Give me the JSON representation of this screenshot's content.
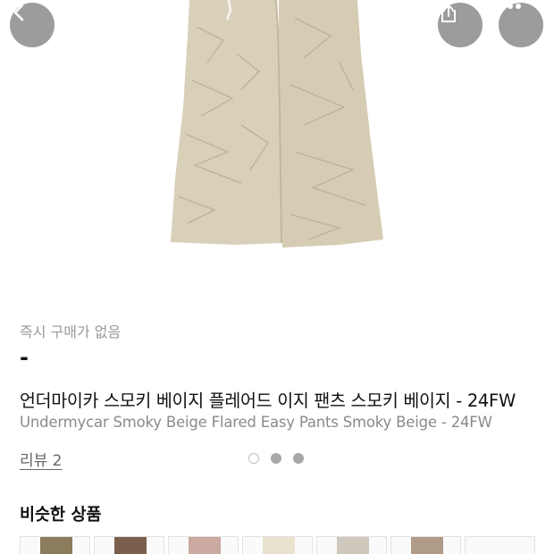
{
  "header": {
    "back_icon": "chevron-left-icon",
    "share_icon": "share-icon",
    "more_icon": "more-horizontal-icon"
  },
  "product": {
    "status": "즉시 구매가 없음",
    "price": "-",
    "title_ko": "언더마이카 스모키 베이지 플레어드 이지 팬츠 스모키 베이지 - 24FW",
    "title_en": "Undermycar Smoky Beige Flared Easy Pants Smoky Beige - 24FW",
    "review_label": "리뷰 2",
    "image_colors": {
      "pants": "#d9d0ba",
      "shadow": "#b9ae95"
    }
  },
  "carousel": {
    "count": 3,
    "active_index": 0
  },
  "similar": {
    "title": "비슷한 상품",
    "thumbnail_colors": [
      "#8b7c5c",
      "#7a5f4c",
      "#c9a9a0",
      "#e8e2cf",
      "#cfc8bc",
      "#b09a88",
      "#ffffff"
    ]
  }
}
